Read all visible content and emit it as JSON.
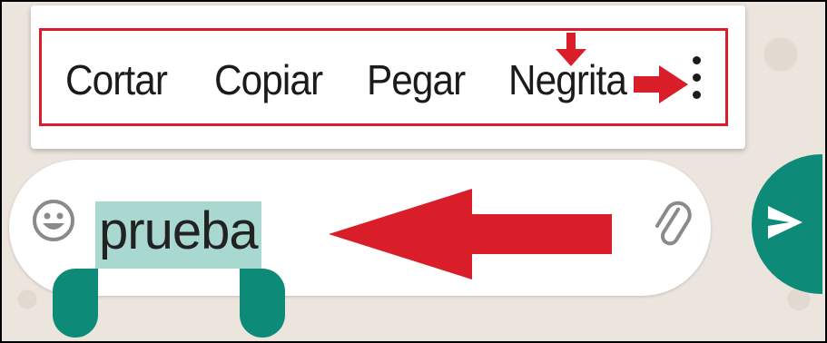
{
  "context_menu": {
    "items": [
      {
        "label": "Cortar"
      },
      {
        "label": "Copiar"
      },
      {
        "label": "Pegar"
      },
      {
        "label": "Negrita"
      }
    ],
    "more_icon": "more-vertical-icon"
  },
  "composer": {
    "selected_text": "prueba",
    "emoji_icon": "emoji-icon",
    "attach_icon": "paperclip-icon",
    "send_icon": "send-icon"
  },
  "colors": {
    "annotation_red": "#d91e2a",
    "accent_green": "#0e8a78",
    "selection": "#a8d8cf"
  }
}
